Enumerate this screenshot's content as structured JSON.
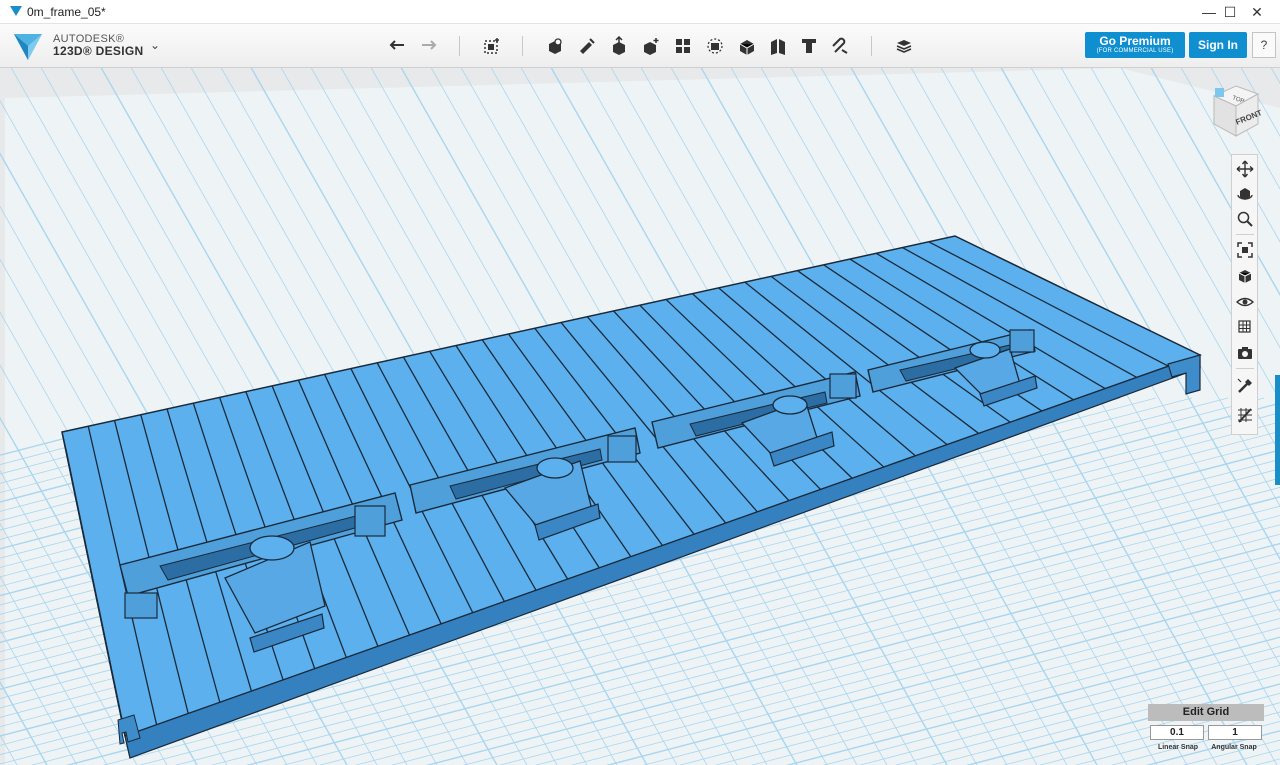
{
  "window": {
    "title": "0m_frame_05*",
    "controls": {
      "minimize": "—",
      "maximize": "☐",
      "close": "✕"
    }
  },
  "app": {
    "brand_line1": "AUTODESK®",
    "brand_line2": "123D® DESIGN",
    "menu_chevron": "⌄"
  },
  "toolbar": {
    "tools": [
      "undo-icon",
      "redo-icon",
      "transform-icon",
      "primitives-icon",
      "sketch-icon",
      "construct-icon",
      "modify-icon",
      "pattern-icon",
      "group-icon",
      "combine-icon",
      "measure-icon",
      "text-icon",
      "snap-icon",
      "material-icon"
    ],
    "premium_label": "Go Premium",
    "premium_sub": "(FOR COMMERCIAL USE)",
    "signin_label": "Sign In",
    "help_label": "?"
  },
  "viewcube": {
    "top_label": "TOP",
    "front_label": "FRONT"
  },
  "nav": {
    "items": [
      "pan-icon",
      "orbit-icon",
      "zoom-icon",
      "fit-icon",
      "views-icon",
      "visibility-icon",
      "materials-outlines-icon",
      "screenshot-icon",
      "snap-settings-icon",
      "edit-grid-icon"
    ]
  },
  "snap": {
    "edit_grid_label": "Edit Grid",
    "linear_value": "0.1",
    "angular_value": "1",
    "linear_label": "Linear Snap",
    "angular_label": "Angular Snap"
  },
  "colors": {
    "accent": "#0f8fcf",
    "model_blue": "#5aa7e6",
    "grid_line": "#a9d6ef",
    "viewport_bg": "#e7e9ea"
  }
}
